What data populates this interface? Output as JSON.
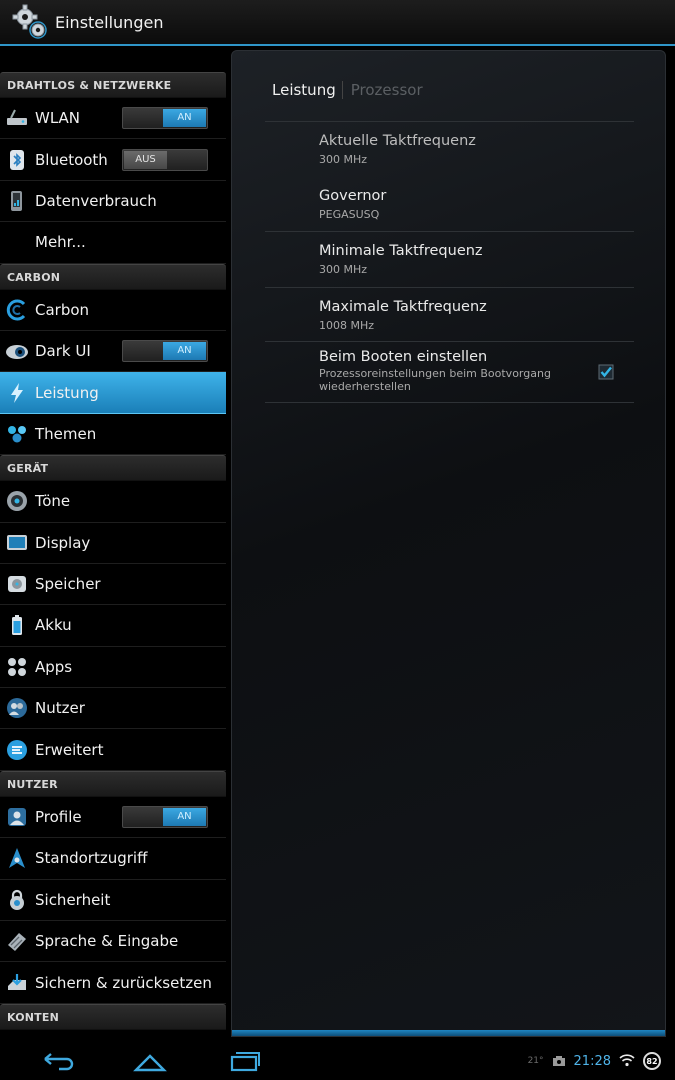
{
  "app": {
    "title": "Einstellungen",
    "icon": "gear-icon"
  },
  "colors": {
    "accent": "#33b5e5",
    "toggle_on": "#2a8fcc",
    "toggle_off": "#555555"
  },
  "sections": {
    "s1": "DRAHTLOS & NETZWERKE",
    "s2": "CARBON",
    "s3": "GERÄT",
    "s4": "NUTZER",
    "s5": "KONTEN"
  },
  "items": {
    "wlan": {
      "label": "WLAN",
      "toggle": "AN"
    },
    "bluetooth": {
      "label": "Bluetooth",
      "toggle": "AUS"
    },
    "datenverbrauch": {
      "label": "Datenverbrauch"
    },
    "mehr": {
      "label": "Mehr..."
    },
    "carbon": {
      "label": "Carbon"
    },
    "darkui": {
      "label": "Dark UI",
      "toggle": "AN"
    },
    "leistung": {
      "label": "Leistung"
    },
    "themen": {
      "label": "Themen"
    },
    "toene": {
      "label": "Töne"
    },
    "display": {
      "label": "Display"
    },
    "speicher": {
      "label": "Speicher"
    },
    "akku": {
      "label": "Akku"
    },
    "apps": {
      "label": "Apps"
    },
    "nutzer": {
      "label": "Nutzer"
    },
    "erweitert": {
      "label": "Erweitert"
    },
    "profile": {
      "label": "Profile",
      "toggle": "AN"
    },
    "standort": {
      "label": "Standortzugriff"
    },
    "sicherheit": {
      "label": "Sicherheit"
    },
    "sprache": {
      "label": "Sprache & Eingabe"
    },
    "sichern": {
      "label": "Sichern & zurücksetzen"
    }
  },
  "content": {
    "tab_active": "Leistung",
    "tab_inactive": "Prozessor",
    "prefs": [
      {
        "title": "Aktuelle Taktfrequenz",
        "summary": "300 MHz"
      },
      {
        "title": "Governor",
        "summary": "PEGASUSQ"
      },
      {
        "title": "Minimale Taktfrequenz",
        "summary": "300 MHz"
      },
      {
        "title": "Maximale Taktfrequenz",
        "summary": "1008 MHz"
      },
      {
        "title": "Beim Booten einstellen",
        "summary": "Prozessoreinstellungen beim Bootvorgang wiederherstellen",
        "checked": true
      }
    ]
  },
  "statusbar": {
    "temp": "21°",
    "clock": "21:28",
    "battery": "82"
  }
}
